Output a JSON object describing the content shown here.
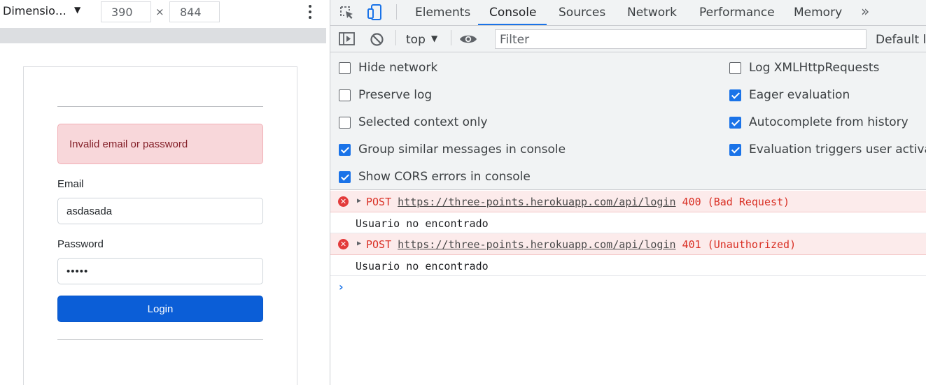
{
  "device_toolbar": {
    "dimensions_label": "Dimensio…",
    "width": "390",
    "height": "844",
    "times": "×"
  },
  "login_page": {
    "alert": "Invalid email or password",
    "email_label": "Email",
    "email_value": "asdasada",
    "password_label": "Password",
    "password_value": "•••••",
    "login_button": "Login"
  },
  "devtools": {
    "tabs": [
      "Elements",
      "Console",
      "Sources",
      "Network",
      "Performance",
      "Memory"
    ],
    "active_tab": "Console",
    "more_tabs": "»",
    "context": "top",
    "filter_placeholder": "Filter",
    "levels": "Default levels",
    "settings": [
      {
        "label": "Hide network",
        "checked": false
      },
      {
        "label": "Preserve log",
        "checked": false
      },
      {
        "label": "Selected context only",
        "checked": false
      },
      {
        "label": "Group similar messages in console",
        "checked": true
      },
      {
        "label": "Show CORS errors in console",
        "checked": true
      },
      {
        "label": "Log XMLHttpRequests",
        "checked": false
      },
      {
        "label": "Eager evaluation",
        "checked": true
      },
      {
        "label": "Autocomplete from history",
        "checked": true
      },
      {
        "label": "Evaluation triggers user activation",
        "checked": true
      }
    ],
    "messages": [
      {
        "type": "error",
        "method": "POST",
        "url": "https://three-points.herokuapp.com/api/login",
        "status": "400 (Bad Request)"
      },
      {
        "type": "log",
        "text": "Usuario no encontrado"
      },
      {
        "type": "error",
        "method": "POST",
        "url": "https://three-points.herokuapp.com/api/login",
        "status": "401 (Unauthorized)"
      },
      {
        "type": "log",
        "text": "Usuario no encontrado"
      }
    ],
    "prompt": "›"
  },
  "colors": {
    "accent": "#1a73e8",
    "error_text": "#d93025",
    "error_bg": "#fcebeb",
    "alert_bg": "#f8d7da",
    "alert_text": "#842029",
    "login_button": "#0b5ed7"
  }
}
